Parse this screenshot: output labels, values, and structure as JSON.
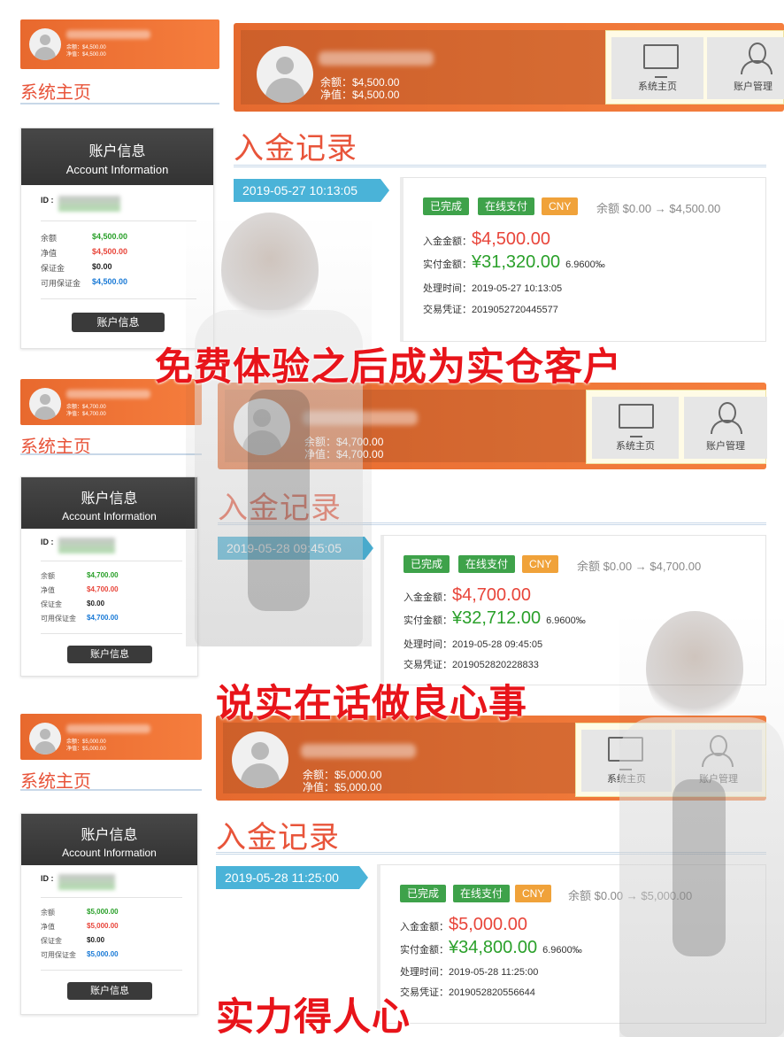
{
  "slogans": [
    "免费体验之后成为实仓客户",
    "说实在话做良心事",
    "实力得人心"
  ],
  "blocks": [
    {
      "mini": {
        "balance": "余额：$4,500.00",
        "net": "净值：$4,500.00"
      },
      "home_title": "系统主页",
      "account": {
        "title": "账户信息",
        "subtitle": "Account Information",
        "id_label": "ID :",
        "rows": [
          {
            "k": "余额",
            "v": "$4,500.00"
          },
          {
            "k": "净值",
            "v": "$4,500.00"
          },
          {
            "k": "保证金",
            "v": "$0.00"
          },
          {
            "k": "可用保证金",
            "v": "$4,500.00"
          }
        ],
        "button": "账户信息"
      },
      "header": {
        "balance": "余额：$4,500.00",
        "net": "净值：$4,500.00",
        "nav": [
          "系统主页",
          "账户管理"
        ]
      },
      "section_title": "入金记录",
      "date": "2019-05-27   10:13:05",
      "record": {
        "badges": [
          "已完成",
          "在线支付",
          "CNY"
        ],
        "balance_change": "余额 $0.00 → $4,500.00",
        "deposit_label": "入金金额：",
        "deposit": "$4,500.00",
        "paid_label": "实付金额：",
        "paid": "¥31,320.00",
        "rate": "6.9600‰",
        "time": "处理时间：2019-05-27 10:13:05",
        "voucher": "交易凭证：2019052720445577"
      }
    },
    {
      "mini": {
        "balance": "余额：$4,700.00",
        "net": "净值：$4,700.00"
      },
      "home_title": "系统主页",
      "account": {
        "title": "账户信息",
        "subtitle": "Account Information",
        "id_label": "ID :",
        "rows": [
          {
            "k": "余额",
            "v": "$4,700.00"
          },
          {
            "k": "净值",
            "v": "$4,700.00"
          },
          {
            "k": "保证金",
            "v": "$0.00"
          },
          {
            "k": "可用保证金",
            "v": "$4,700.00"
          }
        ],
        "button": "账户信息"
      },
      "header": {
        "balance": "余额：$4,700.00",
        "net": "净值：$4,700.00",
        "nav": [
          "系统主页",
          "账户管理"
        ]
      },
      "section_title": "入金记录",
      "date": "2019-05-28   09:45:05",
      "record": {
        "badges": [
          "已完成",
          "在线支付",
          "CNY"
        ],
        "balance_change": "余额 $0.00 → $4,700.00",
        "deposit_label": "入金金额：",
        "deposit": "$4,700.00",
        "paid_label": "实付金额：",
        "paid": "¥32,712.00",
        "rate": "6.9600‰",
        "time": "处理时间：2019-05-28 09:45:05",
        "voucher": "交易凭证：2019052820228833"
      }
    },
    {
      "mini": {
        "balance": "余额：$5,000.00",
        "net": "净值：$5,000.00"
      },
      "home_title": "系统主页",
      "account": {
        "title": "账户信息",
        "subtitle": "Account Information",
        "id_label": "ID :",
        "rows": [
          {
            "k": "余额",
            "v": "$5,000.00"
          },
          {
            "k": "净值",
            "v": "$5,000.00"
          },
          {
            "k": "保证金",
            "v": "$0.00"
          },
          {
            "k": "可用保证金",
            "v": "$5,000.00"
          }
        ],
        "button": "账户信息"
      },
      "header": {
        "balance": "余额：$5,000.00",
        "net": "净值：$5,000.00",
        "nav": [
          "系统主页",
          "账户管理"
        ]
      },
      "section_title": "入金记录",
      "date": "2019-05-28   11:25:00",
      "record": {
        "badges": [
          "已完成",
          "在线支付",
          "CNY"
        ],
        "balance_change": "余额 $0.00 → $5,000.00",
        "deposit_label": "入金金额：",
        "deposit": "$5,000.00",
        "paid_label": "实付金额：",
        "paid": "¥34,800.00",
        "rate": "6.9600‰",
        "time": "处理时间：2019-05-28 11:25:00",
        "voucher": "交易凭证：2019052820556644"
      }
    }
  ]
}
